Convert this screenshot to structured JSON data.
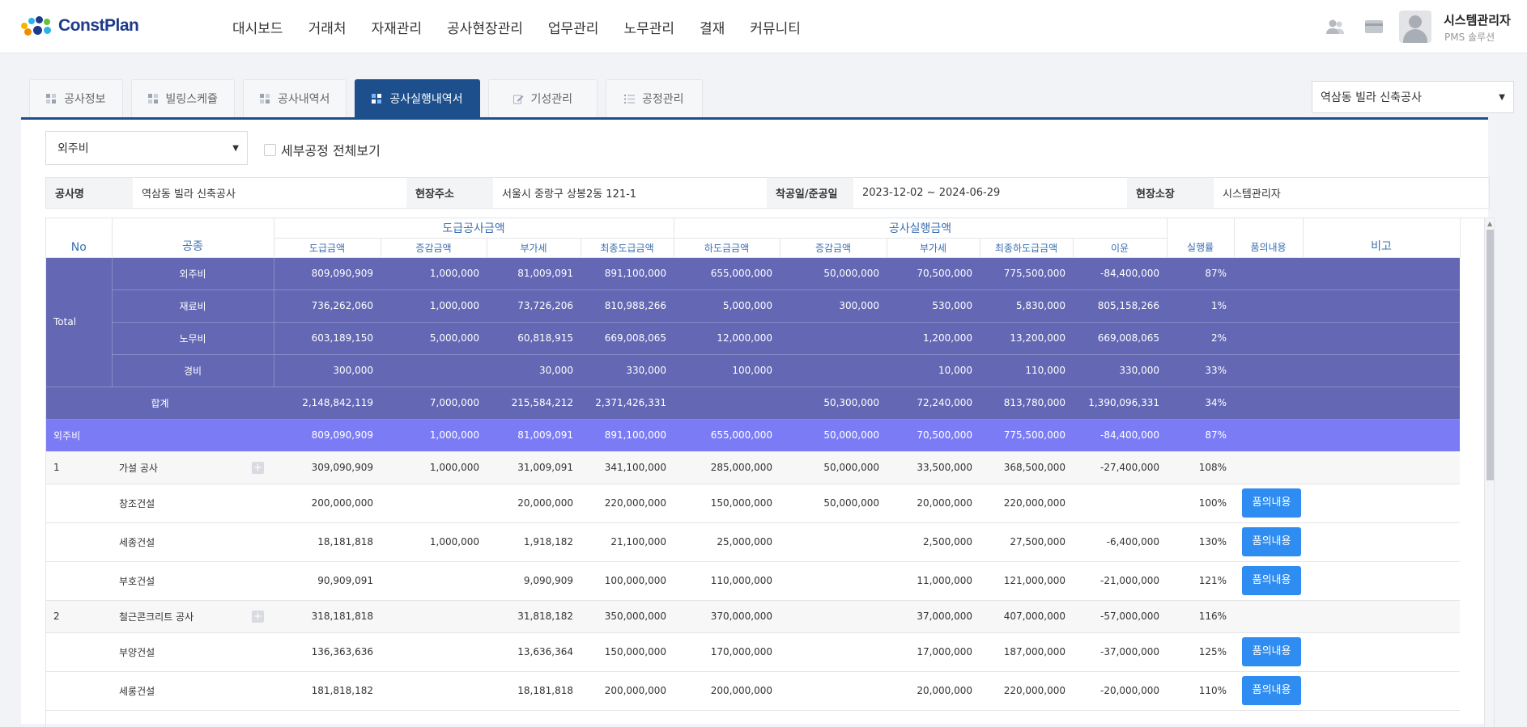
{
  "brand": {
    "name": "ConstPlan"
  },
  "nav": [
    "대시보드",
    "거래처",
    "자재관리",
    "공사현장관리",
    "업무관리",
    "노무관리",
    "결재",
    "커뮤니티"
  ],
  "header_icons": [
    "users-icon",
    "card-icon"
  ],
  "user": {
    "name": "시스템관리자",
    "role": "PMS 솔루션"
  },
  "tabs": [
    {
      "label": "공사정보",
      "icon": "grid-icon",
      "active": false
    },
    {
      "label": "빌링스케쥴",
      "icon": "grid-icon",
      "active": false
    },
    {
      "label": "공사내역서",
      "icon": "grid-icon",
      "active": false
    },
    {
      "label": "공사실행내역서",
      "icon": "grid-icon",
      "active": true
    },
    {
      "label": "기성관리",
      "icon": "edit-icon",
      "active": false
    },
    {
      "label": "공정관리",
      "icon": "list-icon",
      "active": false
    }
  ],
  "project_select": {
    "value": "역삼동 빌라 신축공사"
  },
  "filter": {
    "category": "외주비",
    "checkbox_label": "세부공정 전체보기"
  },
  "info": {
    "name_label": "공사명",
    "name": "역삼동 빌라 신축공사",
    "addr_label": "현장주소",
    "addr": "서울시 중랑구 상봉2동 121-1",
    "period_label": "착공일/준공일",
    "period": "2023-12-02 ~ 2024-06-29",
    "manager_label": "현장소장",
    "manager": "시스템관리자"
  },
  "table": {
    "headers": {
      "no": "No",
      "trade": "공종",
      "contract_group": "도급공사금액",
      "exec_group": "공사실행금액",
      "contract_amount": "도급금액",
      "contract_change": "증감금액",
      "contract_vat": "부가세",
      "contract_final": "최종도급금액",
      "sub_amount": "하도금금액",
      "sub_change": "증감금액",
      "sub_vat": "부가세",
      "sub_final": "최종하도급금액",
      "profit": "이윤",
      "rate": "실행률",
      "approval": "품의내용",
      "remark": "비고"
    },
    "total_label": "Total",
    "totals": [
      {
        "name": "외주비",
        "cols": [
          "809,090,909",
          "1,000,000",
          "81,009,091",
          "891,100,000",
          "655,000,000",
          "50,000,000",
          "70,500,000",
          "775,500,000",
          "-84,400,000",
          "87%"
        ]
      },
      {
        "name": "재료비",
        "cols": [
          "736,262,060",
          "1,000,000",
          "73,726,206",
          "810,988,266",
          "5,000,000",
          "300,000",
          "530,000",
          "5,830,000",
          "805,158,266",
          "1%"
        ]
      },
      {
        "name": "노무비",
        "cols": [
          "603,189,150",
          "5,000,000",
          "60,818,915",
          "669,008,065",
          "12,000,000",
          "",
          "1,200,000",
          "13,200,000",
          "669,008,065",
          "2%"
        ]
      },
      {
        "name": "경비",
        "cols": [
          "300,000",
          "",
          "30,000",
          "330,000",
          "100,000",
          "",
          "10,000",
          "110,000",
          "330,000",
          "33%"
        ]
      }
    ],
    "sum": {
      "name": "합계",
      "cols": [
        "2,148,842,119",
        "7,000,000",
        "215,584,212",
        "2,371,426,331",
        "",
        "50,300,000",
        "72,240,000",
        "813,780,000",
        "1,390,096,331",
        "34%"
      ]
    },
    "category": {
      "name": "외주비",
      "cols": [
        "809,090,909",
        "1,000,000",
        "81,009,091",
        "891,100,000",
        "655,000,000",
        "50,000,000",
        "70,500,000",
        "775,500,000",
        "-84,400,000",
        "87%"
      ]
    },
    "button_label": "품의내용",
    "rows": [
      {
        "kind": "grp",
        "no": "1",
        "name": "가설 공사",
        "cols": [
          "309,090,909",
          "1,000,000",
          "31,009,091",
          "341,100,000",
          "285,000,000",
          "50,000,000",
          "33,500,000",
          "368,500,000",
          "-27,400,000",
          "108%"
        ]
      },
      {
        "kind": "sub",
        "no": "",
        "name": "창조건설",
        "cols": [
          "200,000,000",
          "",
          "20,000,000",
          "220,000,000",
          "150,000,000",
          "50,000,000",
          "20,000,000",
          "220,000,000",
          "",
          "100%"
        ]
      },
      {
        "kind": "sub",
        "no": "",
        "name": "세종건설",
        "cols": [
          "18,181,818",
          "1,000,000",
          "1,918,182",
          "21,100,000",
          "25,000,000",
          "",
          "2,500,000",
          "27,500,000",
          "-6,400,000",
          "130%"
        ]
      },
      {
        "kind": "sub",
        "no": "",
        "name": "부호건설",
        "cols": [
          "90,909,091",
          "",
          "9,090,909",
          "100,000,000",
          "110,000,000",
          "",
          "11,000,000",
          "121,000,000",
          "-21,000,000",
          "121%"
        ]
      },
      {
        "kind": "grp",
        "no": "2",
        "name": "철근콘크리트 공사",
        "cols": [
          "318,181,818",
          "",
          "31,818,182",
          "350,000,000",
          "370,000,000",
          "",
          "37,000,000",
          "407,000,000",
          "-57,000,000",
          "116%"
        ]
      },
      {
        "kind": "sub",
        "no": "",
        "name": "부양건설",
        "cols": [
          "136,363,636",
          "",
          "13,636,364",
          "150,000,000",
          "170,000,000",
          "",
          "17,000,000",
          "187,000,000",
          "-37,000,000",
          "125%"
        ]
      },
      {
        "kind": "sub",
        "no": "",
        "name": "세롱건설",
        "cols": [
          "181,818,182",
          "",
          "18,181,818",
          "200,000,000",
          "200,000,000",
          "",
          "20,000,000",
          "220,000,000",
          "-20,000,000",
          "110%"
        ]
      }
    ]
  },
  "colors": {
    "primary": "#1c4f8c",
    "total_row": "#6367b4",
    "category_row": "#7b7cf5",
    "button": "#2f8cf0"
  }
}
